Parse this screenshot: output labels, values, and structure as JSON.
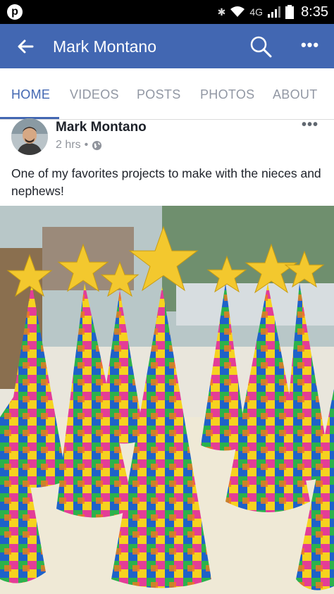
{
  "status_bar": {
    "left_icon": "pinterest-icon",
    "network": "4G",
    "time": "8:35"
  },
  "header": {
    "title": "Mark Montano",
    "back_icon": "arrow-left-icon",
    "search_icon": "search-icon",
    "more_label": "•••"
  },
  "tabs": [
    {
      "label": "HOME"
    },
    {
      "label": "VIDEOS"
    },
    {
      "label": "POSTS"
    },
    {
      "label": "PHOTOS"
    },
    {
      "label": "ABOUT"
    }
  ],
  "post": {
    "author": "Mark Montano",
    "time": "2 hrs",
    "separator": "•",
    "more_label": "•••",
    "text": "One of my favorites projects to make with the nieces and nephews!"
  },
  "colors": {
    "brand": "#4267b2",
    "tab_inactive": "#9197a3",
    "text": "#1d2129",
    "meta": "#90949c"
  }
}
